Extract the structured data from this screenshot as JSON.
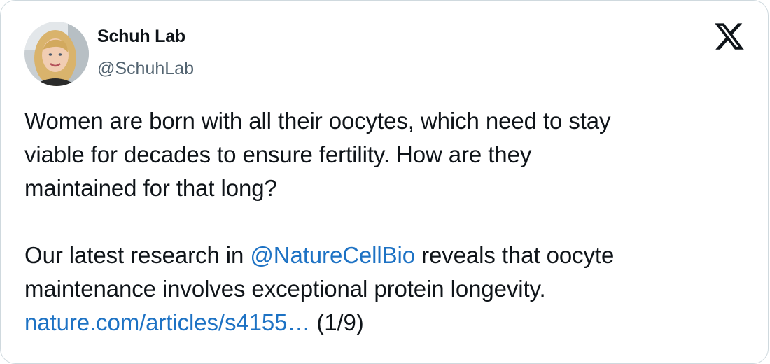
{
  "author": {
    "name": "Schuh Lab",
    "handle": "@SchuhLab",
    "avatar_icon": "profile-photo"
  },
  "platform_icon": "x-logo-icon",
  "tweet": {
    "para1": {
      "line1": "Women are born with all their oocytes, which need to stay",
      "line2": "viable for decades to ensure fertility. How are they",
      "line3": "maintained for that long?"
    },
    "para2": {
      "line1_prefix": "Our latest research in ",
      "mention": "@NatureCellBio",
      "line1_suffix": " reveals that oocyte",
      "line2": "maintenance involves exceptional protein longevity.",
      "link": "nature.com/articles/s4155…",
      "counter": " (1/9)"
    }
  },
  "colors": {
    "text": "#0f1419",
    "secondary": "#536471",
    "link": "#1d72c4",
    "border": "#cfd9de"
  }
}
